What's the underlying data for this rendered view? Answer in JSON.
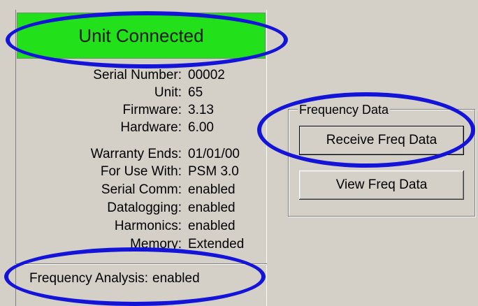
{
  "status": {
    "text": "Unit Connected",
    "color": "#22e11b"
  },
  "device_info": [
    {
      "label": "Serial Number:",
      "value": "00002"
    },
    {
      "label": "Unit:",
      "value": "65"
    },
    {
      "label": "Firmware:",
      "value": "3.13"
    },
    {
      "label": "Hardware:",
      "value": "6.00"
    },
    {
      "label": "Warranty Ends:",
      "value": "01/01/00"
    },
    {
      "label": "For Use With:",
      "value": "PSM 3.0"
    },
    {
      "label": "Serial Comm:",
      "value": "enabled"
    },
    {
      "label": "Datalogging:",
      "value": "enabled"
    },
    {
      "label": "Harmonics:",
      "value": "enabled"
    },
    {
      "label": "Memory:",
      "value": "Extended"
    }
  ],
  "frequency_analysis": {
    "label": "Frequency Analysis:",
    "value": "enabled"
  },
  "frequency_group": {
    "title": "Frequency Data",
    "receive_button": "Receive Freq Data",
    "view_button": "View Freq Data"
  },
  "annotation_color": "#1414d8"
}
